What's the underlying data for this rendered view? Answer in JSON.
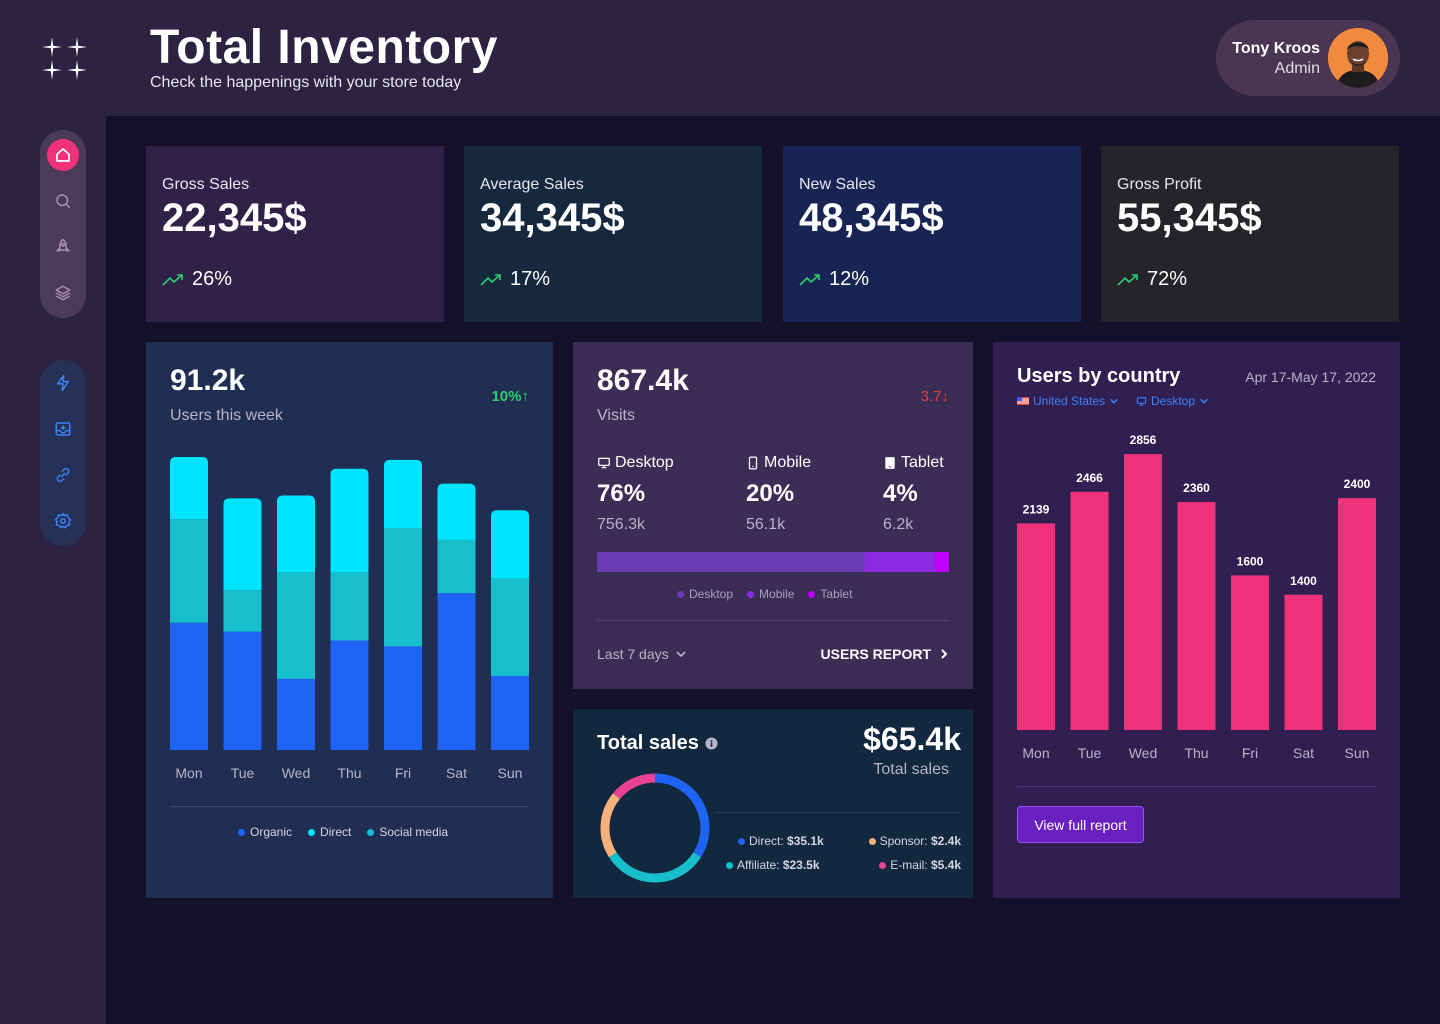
{
  "header": {
    "title": "Total Inventory",
    "subtitle": "Check the happenings with your store today",
    "user": {
      "name": "Tony Kroos",
      "role": "Admin"
    }
  },
  "nav": {
    "group1": [
      "home-icon",
      "search-icon",
      "rocket-icon",
      "layers-icon"
    ],
    "group2": [
      "lightning-icon",
      "inbox-icon",
      "link-icon",
      "settings-icon"
    ]
  },
  "kpis": [
    {
      "label": "Gross Sales",
      "value": "22,345$",
      "trend": "26%"
    },
    {
      "label": "Average Sales",
      "value": "34,345$",
      "trend": "17%"
    },
    {
      "label": "New Sales",
      "value": "48,345$",
      "trend": "12%"
    },
    {
      "label": "Gross Profit",
      "value": "55,345$",
      "trend": "72%"
    }
  ],
  "users_week": {
    "value": "91.2k",
    "label": "Users this week",
    "change": "10%↑",
    "legend": [
      "Organic",
      "Direct",
      "Social media"
    ]
  },
  "visits": {
    "value": "867.4k",
    "label": "Visits",
    "change": "3.7↓",
    "devices": [
      {
        "name": "Desktop",
        "pct": "76%",
        "abs": "756.3k"
      },
      {
        "name": "Mobile",
        "pct": "20%",
        "abs": "56.1k"
      },
      {
        "name": "Tablet",
        "pct": "4%",
        "abs": "6.2k"
      }
    ],
    "legend": [
      "Desktop",
      "Mobile",
      "Tablet"
    ],
    "period": "Last 7 days",
    "report_link": "USERS REPORT"
  },
  "total_sales": {
    "title": "Total sales",
    "value": "$65.4k",
    "label": "Total sales",
    "items": [
      {
        "label": "Direct:",
        "value": "$35.1k"
      },
      {
        "label": "Sponsor:",
        "value": "$2.4k"
      },
      {
        "label": "Affiliate:",
        "value": "$23.5k"
      },
      {
        "label": "E-mail:",
        "value": "$5.4k"
      }
    ]
  },
  "country": {
    "title": "Users by country",
    "date_range": "Apr 17-May 17, 2022",
    "country_filter": "United States",
    "device_filter": "Desktop",
    "button": "View full report"
  },
  "colors": {
    "organic": "#1f63f5",
    "direct": "#00e5ff",
    "social": "#17bfcc",
    "pink": "#f0327a",
    "up_green": "#2ecc71",
    "down_red": "#e0403a"
  },
  "chart_data": [
    {
      "type": "bar",
      "title": "",
      "stacked": true,
      "categories": [
        "Mon",
        "Tue",
        "Wed",
        "Thu",
        "Fri",
        "Sat",
        "Sun"
      ],
      "series": [
        {
          "name": "Organic",
          "values": [
            43,
            40,
            24,
            37,
            35,
            53,
            25
          ]
        },
        {
          "name": "Social media",
          "values": [
            35,
            14,
            36,
            23,
            40,
            18,
            33
          ]
        },
        {
          "name": "Direct",
          "values": [
            21,
            31,
            26,
            35,
            23,
            19,
            23
          ]
        }
      ],
      "legend": "bottom"
    },
    {
      "type": "bar",
      "title": "Users by country",
      "categories": [
        "Mon",
        "Tue",
        "Wed",
        "Thu",
        "Fri",
        "Sat",
        "Sun"
      ],
      "values": [
        2139,
        2466,
        2856,
        2360,
        1600,
        1400,
        2400
      ]
    },
    {
      "type": "pie",
      "title": "Total sales",
      "categories": [
        "Direct",
        "Affiliate",
        "Sponsor",
        "E-mail"
      ],
      "values": [
        35.1,
        23.5,
        2.4,
        5.4
      ]
    },
    {
      "type": "bar",
      "title": "Visits by device",
      "stacked": true,
      "categories": [
        "Desktop",
        "Mobile",
        "Tablet"
      ],
      "values": [
        76,
        20,
        4
      ]
    }
  ]
}
